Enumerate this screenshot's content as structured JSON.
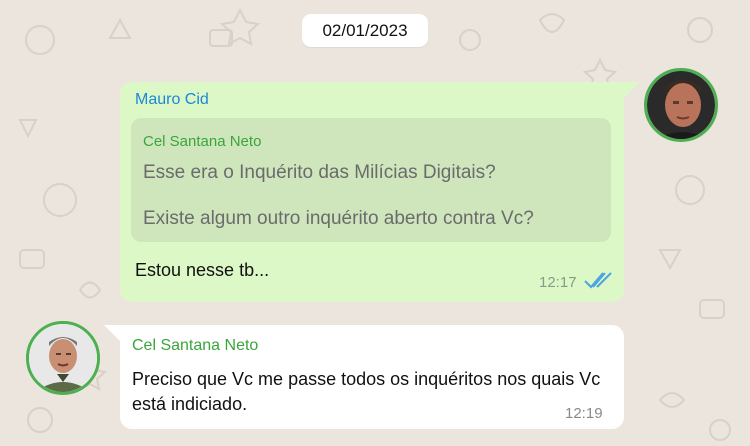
{
  "date_separator": "02/01/2023",
  "messages": [
    {
      "direction": "outgoing",
      "sender": "Mauro Cid",
      "quoted": {
        "author": "Cel Santana Neto",
        "lines": [
          "Esse era o Inquérito das Milícias Digitais?",
          "Existe algum outro inquérito aberto contra Vc?"
        ]
      },
      "text": "Estou nesse tb...",
      "time": "12:17",
      "status_icon": "double-check-icon"
    },
    {
      "direction": "incoming",
      "sender": "Cel Santana Neto",
      "text": "Preciso que Vc me passe todos os inquéritos nos quais Vc está indiciado.",
      "time": "12:19"
    }
  ],
  "colors": {
    "outgoing_bubble": "#dcf8c6",
    "incoming_bubble": "#ffffff",
    "quote_background": "#cfe6bd",
    "sender_out": "#1c87d6",
    "sender_in": "#3aa53a",
    "read_ticks": "#4fa3e0",
    "avatar_ring": "#4caf50",
    "wallpaper": "#ece5dd"
  }
}
